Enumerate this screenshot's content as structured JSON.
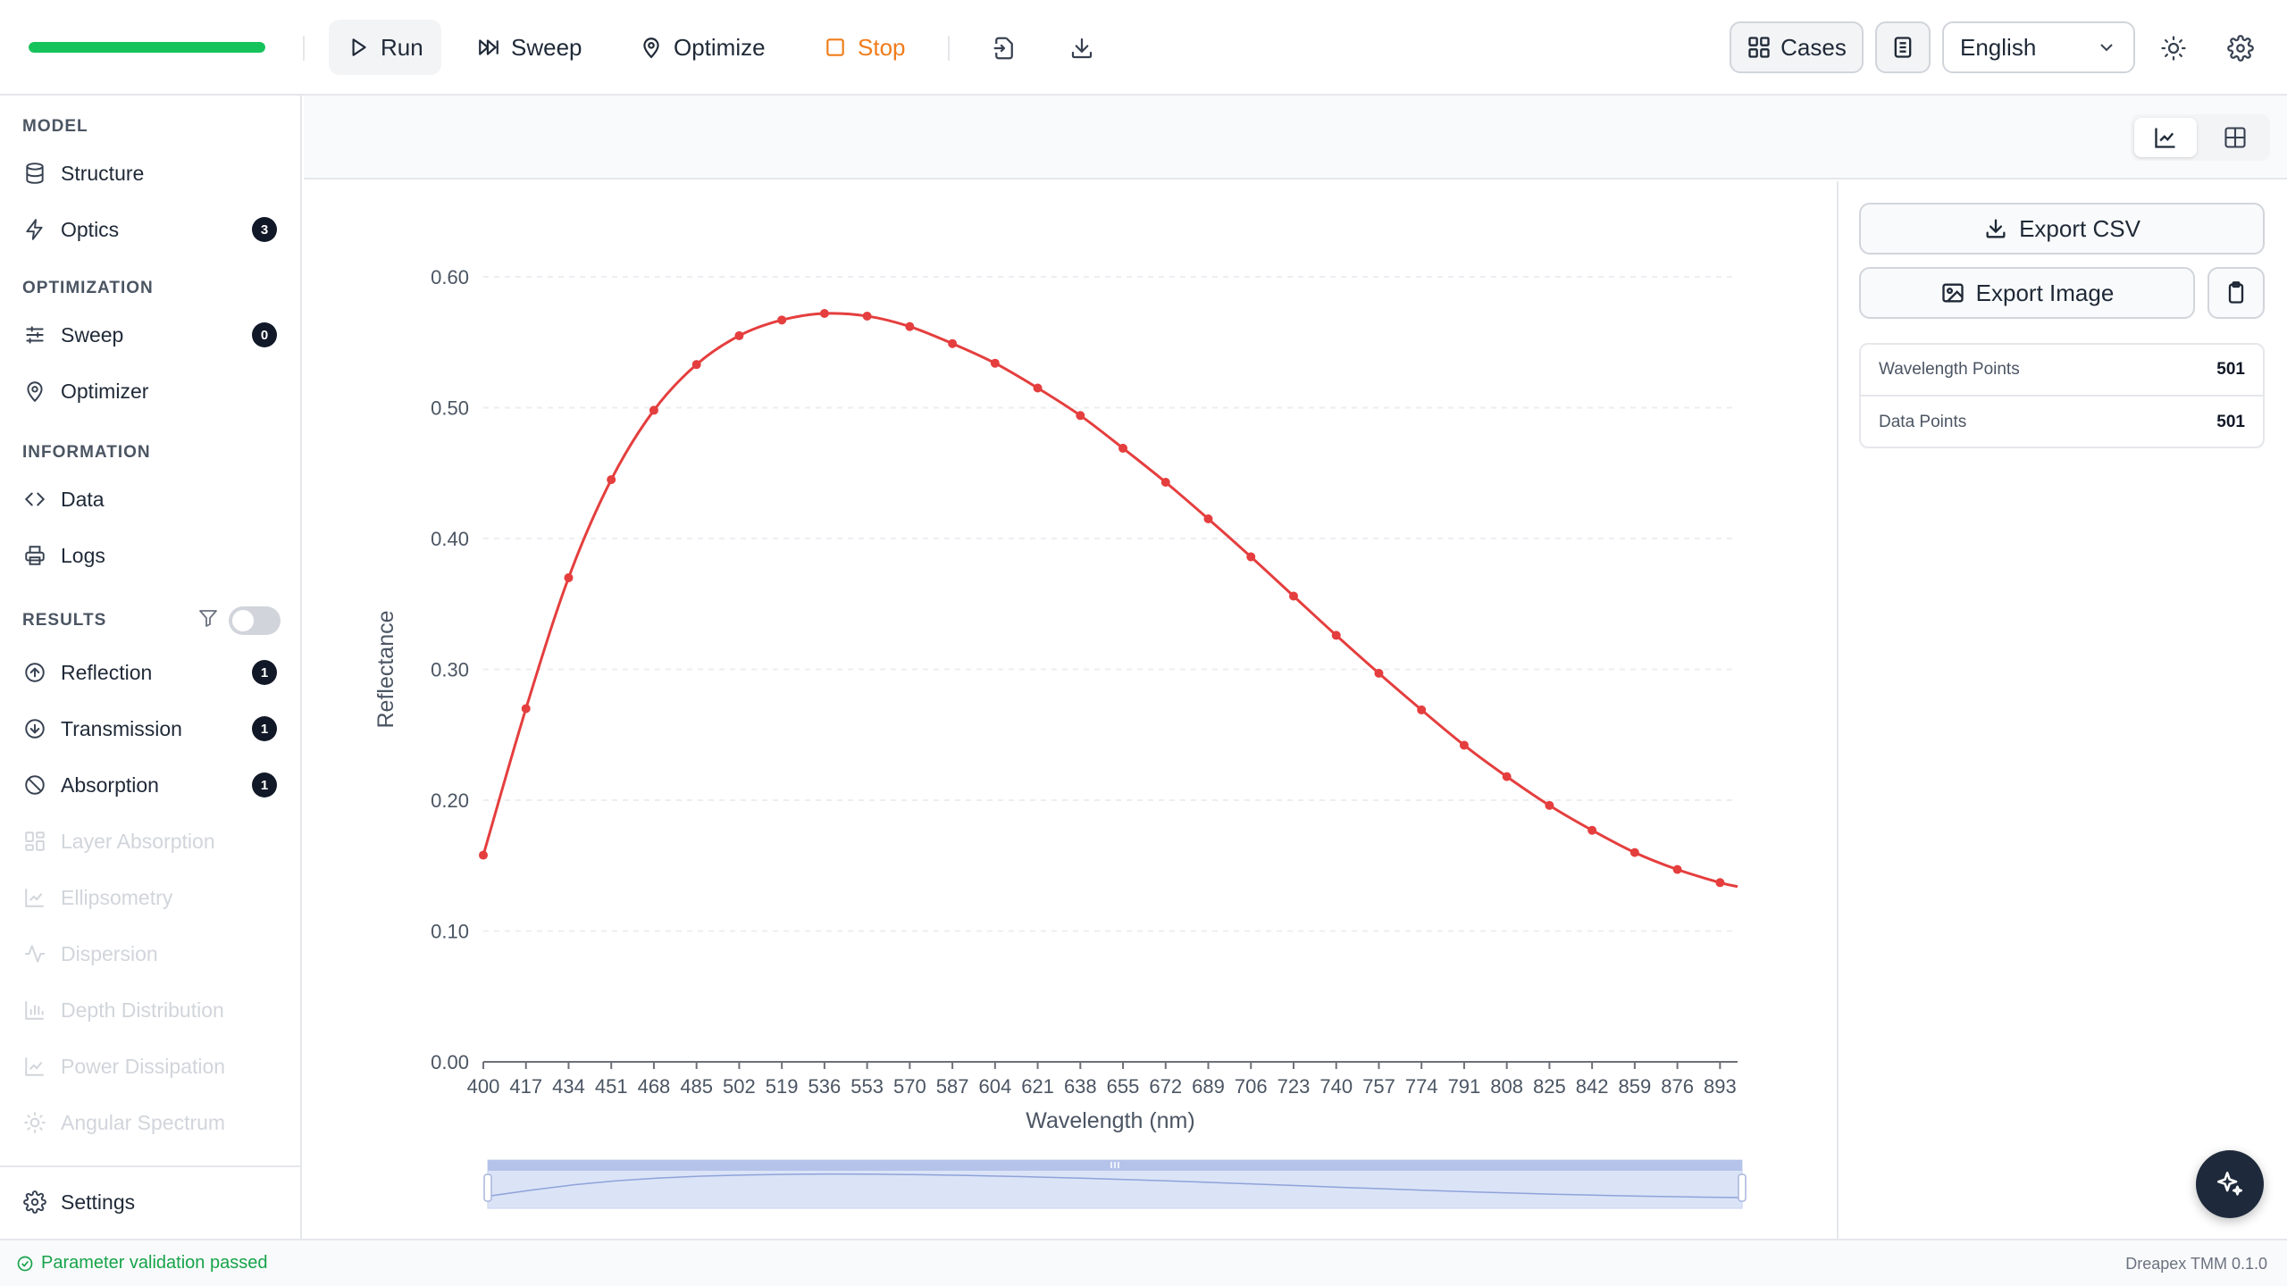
{
  "toolbar": {
    "progress_percent": 100,
    "run_label": "Run",
    "sweep_label": "Sweep",
    "optimize_label": "Optimize",
    "stop_label": "Stop",
    "cases_label": "Cases",
    "language": "English"
  },
  "sidebar": {
    "sections": {
      "model": "MODEL",
      "optimization": "OPTIMIZATION",
      "information": "INFORMATION",
      "results": "RESULTS"
    },
    "items": {
      "structure": "Structure",
      "optics": "Optics",
      "optics_badge": "3",
      "sweep": "Sweep",
      "sweep_badge": "0",
      "optimizer": "Optimizer",
      "data": "Data",
      "logs": "Logs",
      "reflection": "Reflection",
      "reflection_badge": "1",
      "transmission": "Transmission",
      "transmission_badge": "1",
      "absorption": "Absorption",
      "absorption_badge": "1",
      "layer_absorption": "Layer Absorption",
      "ellipsometry": "Ellipsometry",
      "dispersion": "Dispersion",
      "depth_distribution": "Depth Distribution",
      "power_dissipation": "Power Dissipation",
      "angular_spectrum": "Angular Spectrum",
      "settings": "Settings"
    },
    "results_filter_enabled": false
  },
  "right_panel": {
    "export_csv": "Export CSV",
    "export_image": "Export Image",
    "stats": [
      {
        "label": "Wavelength Points",
        "value": "501"
      },
      {
        "label": "Data Points",
        "value": "501"
      }
    ]
  },
  "status": {
    "message": "Parameter validation passed",
    "version": "Dreapex TMM 0.1.0"
  },
  "colors": {
    "series": "#e53e3e",
    "progress": "#16c35a",
    "stop": "#f07c1b",
    "status_ok": "#16a34a"
  },
  "chart_data": {
    "type": "line",
    "xlabel": "Wavelength (nm)",
    "ylabel": "Reflectance",
    "ylim": [
      0,
      0.6
    ],
    "yticks": [
      0.0,
      0.1,
      0.2,
      0.3,
      0.4,
      0.5,
      0.6
    ],
    "ytick_labels": [
      "0.00",
      "0.10",
      "0.20",
      "0.30",
      "0.40",
      "0.50",
      "0.60"
    ],
    "xlim": [
      400,
      900
    ],
    "xticks": [
      400,
      417,
      434,
      451,
      468,
      485,
      502,
      519,
      536,
      553,
      570,
      587,
      604,
      621,
      638,
      655,
      672,
      689,
      706,
      723,
      740,
      757,
      774,
      791,
      808,
      825,
      842,
      859,
      876,
      893
    ],
    "grid": true,
    "series": [
      {
        "values": [
          [
            400,
            0.158
          ],
          [
            417,
            0.27
          ],
          [
            434,
            0.37
          ],
          [
            451,
            0.445
          ],
          [
            468,
            0.498
          ],
          [
            485,
            0.533
          ],
          [
            502,
            0.555
          ],
          [
            519,
            0.567
          ],
          [
            536,
            0.572
          ],
          [
            553,
            0.57
          ],
          [
            570,
            0.562
          ],
          [
            587,
            0.549
          ],
          [
            604,
            0.534
          ],
          [
            621,
            0.515
          ],
          [
            638,
            0.494
          ],
          [
            655,
            0.469
          ],
          [
            672,
            0.443
          ],
          [
            689,
            0.415
          ],
          [
            706,
            0.386
          ],
          [
            723,
            0.356
          ],
          [
            740,
            0.326
          ],
          [
            757,
            0.297
          ],
          [
            774,
            0.269
          ],
          [
            791,
            0.242
          ],
          [
            808,
            0.218
          ],
          [
            825,
            0.196
          ],
          [
            842,
            0.177
          ],
          [
            859,
            0.16
          ],
          [
            876,
            0.147
          ],
          [
            893,
            0.137
          ],
          [
            900,
            0.134
          ]
        ]
      }
    ]
  }
}
